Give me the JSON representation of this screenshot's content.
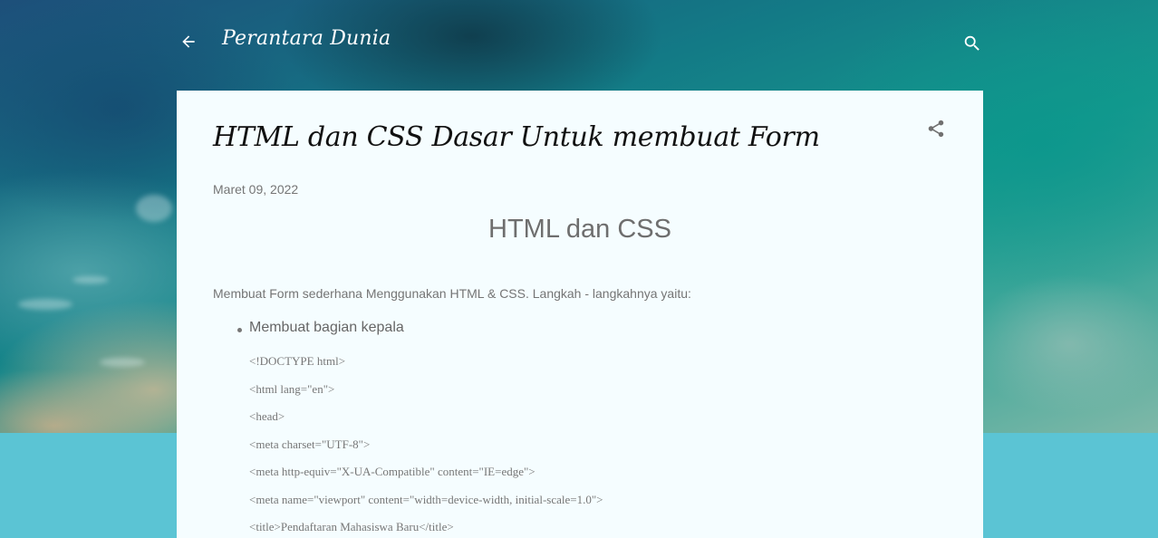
{
  "header": {
    "blog_title": "Perantara Dunia",
    "back_icon": "arrow-left-icon",
    "search_icon": "search-icon"
  },
  "post": {
    "title": "HTML dan CSS Dasar Untuk membuat Form",
    "date": "Maret 09, 2022",
    "share_icon": "share-icon",
    "heading": "HTML dan CSS",
    "intro": "Membuat Form sederhana Menggunakan HTML & CSS. Langkah - langkahnya yaitu:",
    "bullets": [
      "Membuat bagian kepala"
    ],
    "code_lines": [
      "<!DOCTYPE html>",
      "<html lang=\"en\">",
      "<head>",
      "<meta charset=\"UTF-8\">",
      "<meta http-equiv=\"X-UA-Compatible\" content=\"IE=edge\">",
      "<meta name=\"viewport\" content=\"width=device-width, initial-scale=1.0\">",
      "<title>Pendaftaran Mahasiswa Baru</title>"
    ]
  },
  "colors": {
    "page_background": "#5bc4d4",
    "card_background": "#f5fdff",
    "title_text": "#111111",
    "muted_text": "#757575"
  }
}
